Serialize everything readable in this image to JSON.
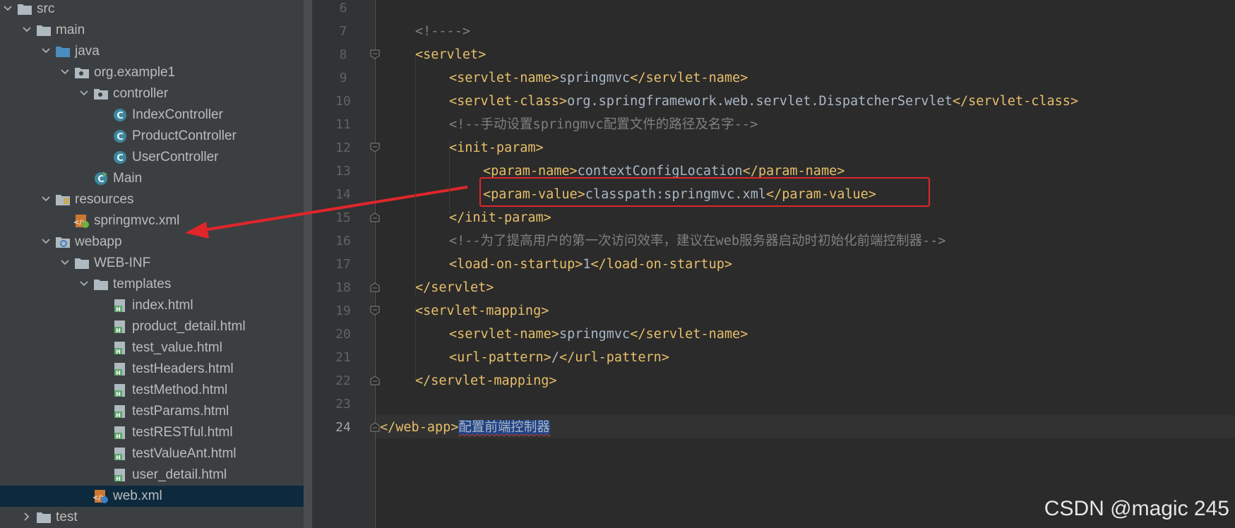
{
  "project_tree": {
    "items": [
      {
        "label": "src",
        "icon": "folder-icon",
        "expanded": true
      },
      {
        "label": "main",
        "icon": "folder-icon",
        "expanded": true
      },
      {
        "label": "java",
        "icon": "source-folder-icon",
        "expanded": true
      },
      {
        "label": "org.example1",
        "icon": "package-icon",
        "expanded": true
      },
      {
        "label": "controller",
        "icon": "package-icon",
        "expanded": true
      },
      {
        "label": "IndexController",
        "icon": "java-class-icon"
      },
      {
        "label": "ProductController",
        "icon": "java-class-icon"
      },
      {
        "label": "UserController",
        "icon": "java-class-icon"
      },
      {
        "label": "Main",
        "icon": "java-main-class-icon"
      },
      {
        "label": "resources",
        "icon": "resources-folder-icon",
        "expanded": true
      },
      {
        "label": "springmvc.xml",
        "icon": "spring-xml-icon"
      },
      {
        "label": "webapp",
        "icon": "web-folder-icon",
        "expanded": true
      },
      {
        "label": "WEB-INF",
        "icon": "folder-icon",
        "expanded": true
      },
      {
        "label": "templates",
        "icon": "folder-icon",
        "expanded": true
      },
      {
        "label": "index.html",
        "icon": "html-file-icon"
      },
      {
        "label": "product_detail.html",
        "icon": "html-file-icon"
      },
      {
        "label": "test_value.html",
        "icon": "html-file-icon"
      },
      {
        "label": "testHeaders.html",
        "icon": "html-file-icon"
      },
      {
        "label": "testMethod.html",
        "icon": "html-file-icon"
      },
      {
        "label": "testParams.html",
        "icon": "html-file-icon"
      },
      {
        "label": "testRESTful.html",
        "icon": "html-file-icon"
      },
      {
        "label": "testValueAnt.html",
        "icon": "html-file-icon"
      },
      {
        "label": "user_detail.html",
        "icon": "html-file-icon"
      },
      {
        "label": "web.xml",
        "icon": "web-xml-icon",
        "selected": true
      },
      {
        "label": "test",
        "icon": "folder-icon",
        "expanded": false
      }
    ]
  },
  "editor": {
    "current_line": "24",
    "lines": [
      {
        "num": "6",
        "segments": []
      },
      {
        "num": "7",
        "segments": [
          {
            "t": "cmt",
            "v": "<!---->"
          }
        ]
      },
      {
        "num": "8",
        "segments": [
          {
            "t": "tag",
            "v": "<servlet>"
          }
        ]
      },
      {
        "num": "9",
        "segments": [
          {
            "t": "tag",
            "v": "<servlet-name>"
          },
          {
            "t": "txt",
            "v": "springmvc"
          },
          {
            "t": "tag",
            "v": "</servlet-name>"
          }
        ]
      },
      {
        "num": "10",
        "segments": [
          {
            "t": "tag",
            "v": "<servlet-class>"
          },
          {
            "t": "txt",
            "v": "org.springframework.web.servlet.DispatcherServlet"
          },
          {
            "t": "tag",
            "v": "</servlet-class>"
          }
        ]
      },
      {
        "num": "11",
        "segments": [
          {
            "t": "cmt",
            "v": "<!--手动设置springmvc配置文件的路径及名字-->"
          }
        ]
      },
      {
        "num": "12",
        "segments": [
          {
            "t": "tag",
            "v": "<init-param>"
          }
        ]
      },
      {
        "num": "13",
        "segments": [
          {
            "t": "tag",
            "v": "<param-name>"
          },
          {
            "t": "txt",
            "v": "contextConfigLocation"
          },
          {
            "t": "tag",
            "v": "</param-name>"
          }
        ]
      },
      {
        "num": "14",
        "segments": [
          {
            "t": "tag",
            "v": "<param-value>"
          },
          {
            "t": "txt",
            "v": "classpath:springmvc.xml"
          },
          {
            "t": "tag",
            "v": "</param-value>"
          }
        ]
      },
      {
        "num": "15",
        "segments": [
          {
            "t": "tag",
            "v": "</init-param>"
          }
        ]
      },
      {
        "num": "16",
        "segments": [
          {
            "t": "cmt",
            "v": "<!--为了提高用户的第一次访问效率，建议在web服务器启动时初始化前端控制器-->"
          }
        ]
      },
      {
        "num": "17",
        "segments": [
          {
            "t": "tag",
            "v": "<load-on-startup>"
          },
          {
            "t": "txt",
            "v": "1"
          },
          {
            "t": "tag",
            "v": "</load-on-startup>"
          }
        ]
      },
      {
        "num": "18",
        "segments": [
          {
            "t": "tag",
            "v": "</servlet>"
          }
        ]
      },
      {
        "num": "19",
        "segments": [
          {
            "t": "tag",
            "v": "<servlet-mapping>"
          }
        ]
      },
      {
        "num": "20",
        "segments": [
          {
            "t": "tag",
            "v": "<servlet-name>"
          },
          {
            "t": "txt",
            "v": "springmvc"
          },
          {
            "t": "tag",
            "v": "</servlet-name>"
          }
        ]
      },
      {
        "num": "21",
        "segments": [
          {
            "t": "tag",
            "v": "<url-pattern>"
          },
          {
            "t": "txt",
            "v": "/"
          },
          {
            "t": "tag",
            "v": "</url-pattern>"
          }
        ]
      },
      {
        "num": "22",
        "segments": [
          {
            "t": "tag",
            "v": "</servlet-mapping>"
          }
        ]
      },
      {
        "num": "23",
        "segments": []
      },
      {
        "num": "24",
        "segments": [
          {
            "t": "tag",
            "v": "</web-app>"
          },
          {
            "t": "hl",
            "v": "配置前端控制器"
          }
        ]
      }
    ]
  },
  "colors": {
    "tag": "#e8bf6a",
    "text": "#a9b7c6",
    "comment": "#808080",
    "annotation_red": "#e0262a"
  },
  "watermark": "CSDN @magic 245"
}
